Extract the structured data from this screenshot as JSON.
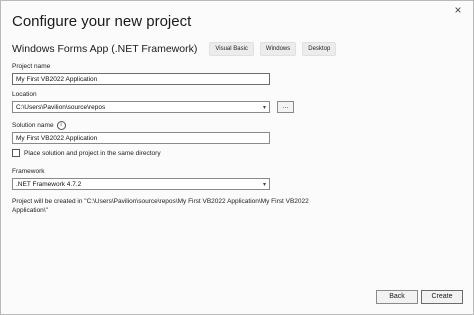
{
  "dialog": {
    "title": "Configure your new project",
    "close_icon": "×"
  },
  "template": {
    "name": "Windows Forms App (.NET Framework)",
    "tags": [
      "Visual Basic",
      "Windows",
      "Desktop"
    ]
  },
  "project_name": {
    "label": "Project name",
    "value": "My First VB2022 Application"
  },
  "location": {
    "label": "Location",
    "value": "C:\\Users\\Pavilion\\source\\repos",
    "browse_label": "..."
  },
  "solution_name": {
    "label": "Solution name",
    "value": "My First VB2022 Application",
    "info_icon": "i"
  },
  "same_directory": {
    "label": "Place solution and project in the same directory",
    "checked": false
  },
  "framework": {
    "label": "Framework",
    "value": ".NET Framework 4.7.2"
  },
  "summary": {
    "text": "Project will be created in \"C:\\Users\\Pavilion\\source\\repos\\My First VB2022 Application\\My First VB2022 Application\\\""
  },
  "buttons": {
    "back": "Back",
    "create": "Create"
  }
}
